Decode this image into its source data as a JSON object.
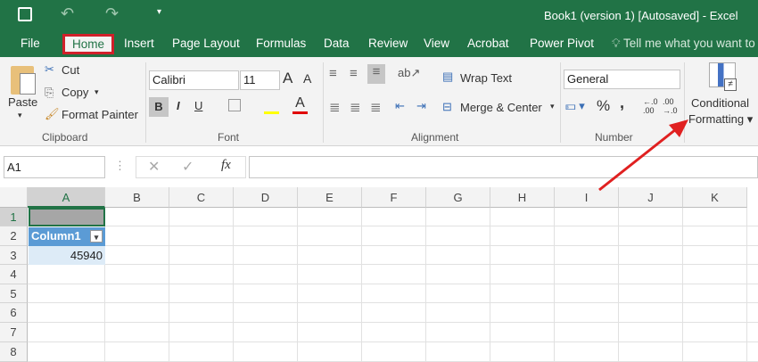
{
  "title": "Book1 (version 1) [Autosaved] - Excel",
  "tabs": [
    "File",
    "Home",
    "Insert",
    "Page Layout",
    "Formulas",
    "Data",
    "Review",
    "View",
    "Acrobat",
    "Power Pivot",
    "Tell me what you want to"
  ],
  "clipboard": {
    "paste": "Paste",
    "cut": "Cut",
    "copy": "Copy",
    "format_painter": "Format Painter",
    "group": "Clipboard"
  },
  "font": {
    "name": "Calibri",
    "size": "11",
    "bold": "B",
    "italic": "I",
    "underline": "U",
    "group": "Font"
  },
  "alignment": {
    "wrap": "Wrap Text",
    "merge": "Merge & Center",
    "group": "Alignment"
  },
  "number": {
    "format": "General",
    "percent": "%",
    "comma": ",",
    "group": "Number"
  },
  "styles": {
    "cond1": "Conditional",
    "cond2": "Formatting"
  },
  "formula_bar": {
    "name_box": "A1",
    "fx": "fx",
    "value": ""
  },
  "columns": [
    "A",
    "B",
    "C",
    "D",
    "E",
    "F",
    "G",
    "H",
    "I",
    "J",
    "K"
  ],
  "rows": [
    "1",
    "2",
    "3",
    "4",
    "5",
    "6",
    "7",
    "8"
  ],
  "cells": {
    "A2": "Column1",
    "A3": "45940"
  },
  "colors": {
    "excel_green": "#217346",
    "highlight": "#d0202a",
    "table_header": "#5b9bd5"
  }
}
